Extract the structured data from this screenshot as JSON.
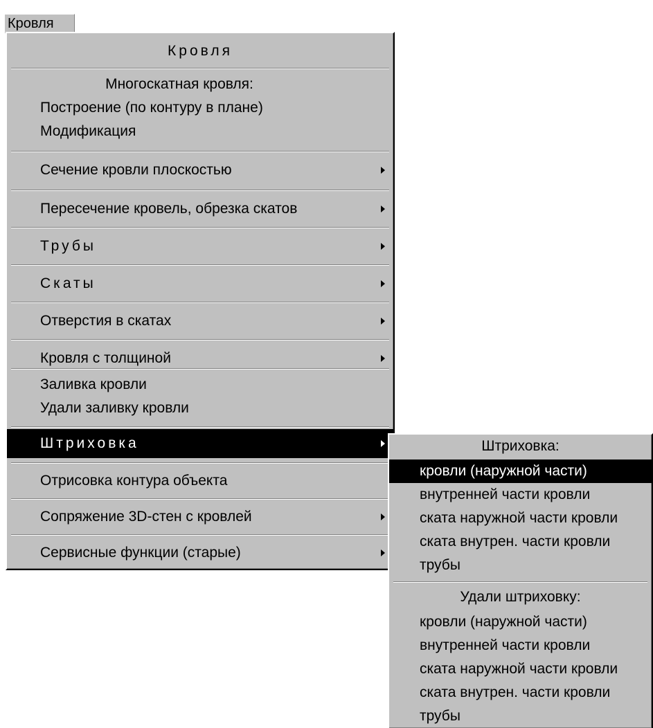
{
  "menubar": {
    "title": "Кровля"
  },
  "main_menu": {
    "header": "Кровля",
    "multi_slope": {
      "title": "Многоскатная кровля:",
      "build": "Построение (по контуру в плане)",
      "modify": "Модификация"
    },
    "items": {
      "section": "Сечение кровли плоскостью",
      "intersect": "Пересечение кровель, обрезка скатов",
      "pipes": "Трубы",
      "slopes": "Скаты",
      "openings": "Отверстия в скатах",
      "thick": "Кровля с толщиной",
      "fill": "Заливка кровли",
      "remove_fill": "Удали заливку кровли",
      "hatch": "Штриховка",
      "outline": "Отрисовка контура объекта",
      "walls": "Сопряжение 3D-стен с кровлей",
      "service": "Сервисные функции (старые)"
    }
  },
  "hatch_submenu": {
    "title": "Штриховка:",
    "items": [
      "кровли (наружной части)",
      "внутренней части кровли",
      "ската наружной части кровли",
      "ската внутрен. части кровли",
      "трубы"
    ],
    "remove_title": "Удали штриховку:",
    "remove_items": [
      "кровли (наружной части)",
      "внутренней части кровли",
      "ската наружной части кровли",
      "ската внутрен. части кровли",
      "трубы"
    ]
  },
  "colors": {
    "menu_bg": "#c0c0c0",
    "highlight_bg": "#000000",
    "highlight_fg": "#ffffff"
  }
}
